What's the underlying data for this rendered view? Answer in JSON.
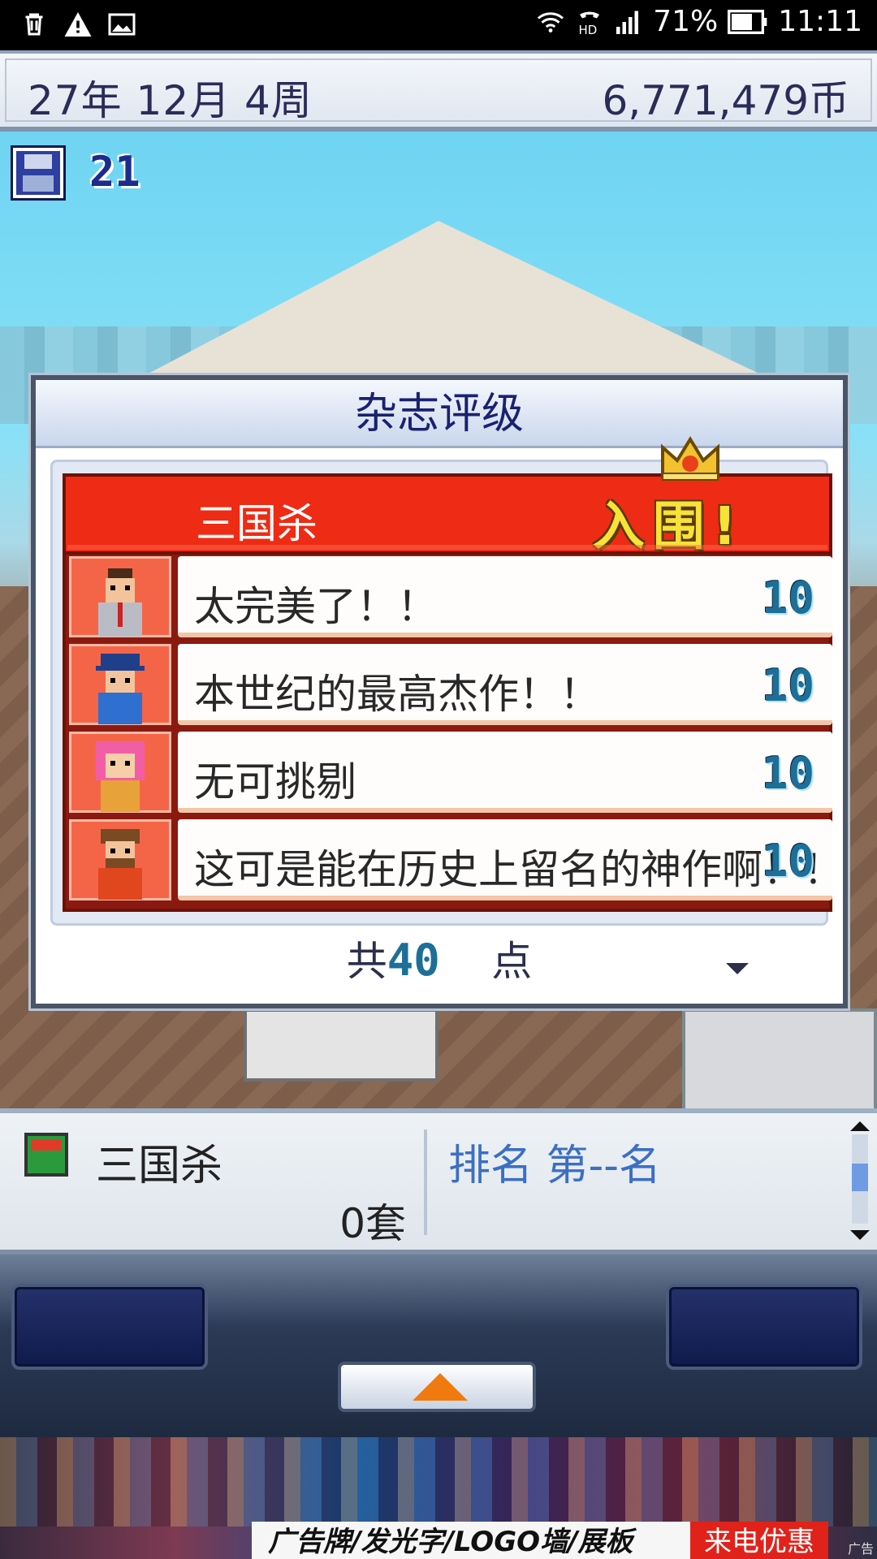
{
  "status_bar": {
    "battery": "71%",
    "time": "11:11",
    "icons": [
      "trash-icon",
      "warning-icon",
      "image-icon",
      "wifi-icon",
      "hd-call-icon",
      "signal-icon",
      "battery-icon"
    ]
  },
  "info_bar": {
    "date": "27年 12月 4周",
    "money": "6,771,479币"
  },
  "scene": {
    "save_count": "21"
  },
  "dialog": {
    "title": "杂志评级",
    "game_name": "三国杀",
    "award": "入围!",
    "reviews": [
      {
        "text": "太完美了！！",
        "score": "10",
        "avatar": "businessman-avatar"
      },
      {
        "text": "本世纪的最高杰作！！",
        "score": "10",
        "avatar": "cap-man-avatar"
      },
      {
        "text": "无可挑剔",
        "score": "10",
        "avatar": "pink-hair-girl-avatar"
      },
      {
        "text": "这可是能在历史上留名的神作啊！！",
        "score": "10",
        "avatar": "bearded-man-avatar"
      }
    ],
    "total_prefix": "共",
    "total_value": "40",
    "total_suffix": "点"
  },
  "info_panel": {
    "game_name": "三国杀",
    "sold": "0套",
    "rank": "排名 第--名"
  },
  "ad": {
    "text": "广告牌/发光字/LOGO墙/展板",
    "cta": "来电优惠",
    "label": "广告"
  },
  "colors": {
    "header_red": "#ee2b14",
    "award_yellow": "#f6e23a",
    "score_blue": "#1d6f98",
    "title_navy": "#1a2170",
    "rank_blue": "#3c6fc2"
  }
}
